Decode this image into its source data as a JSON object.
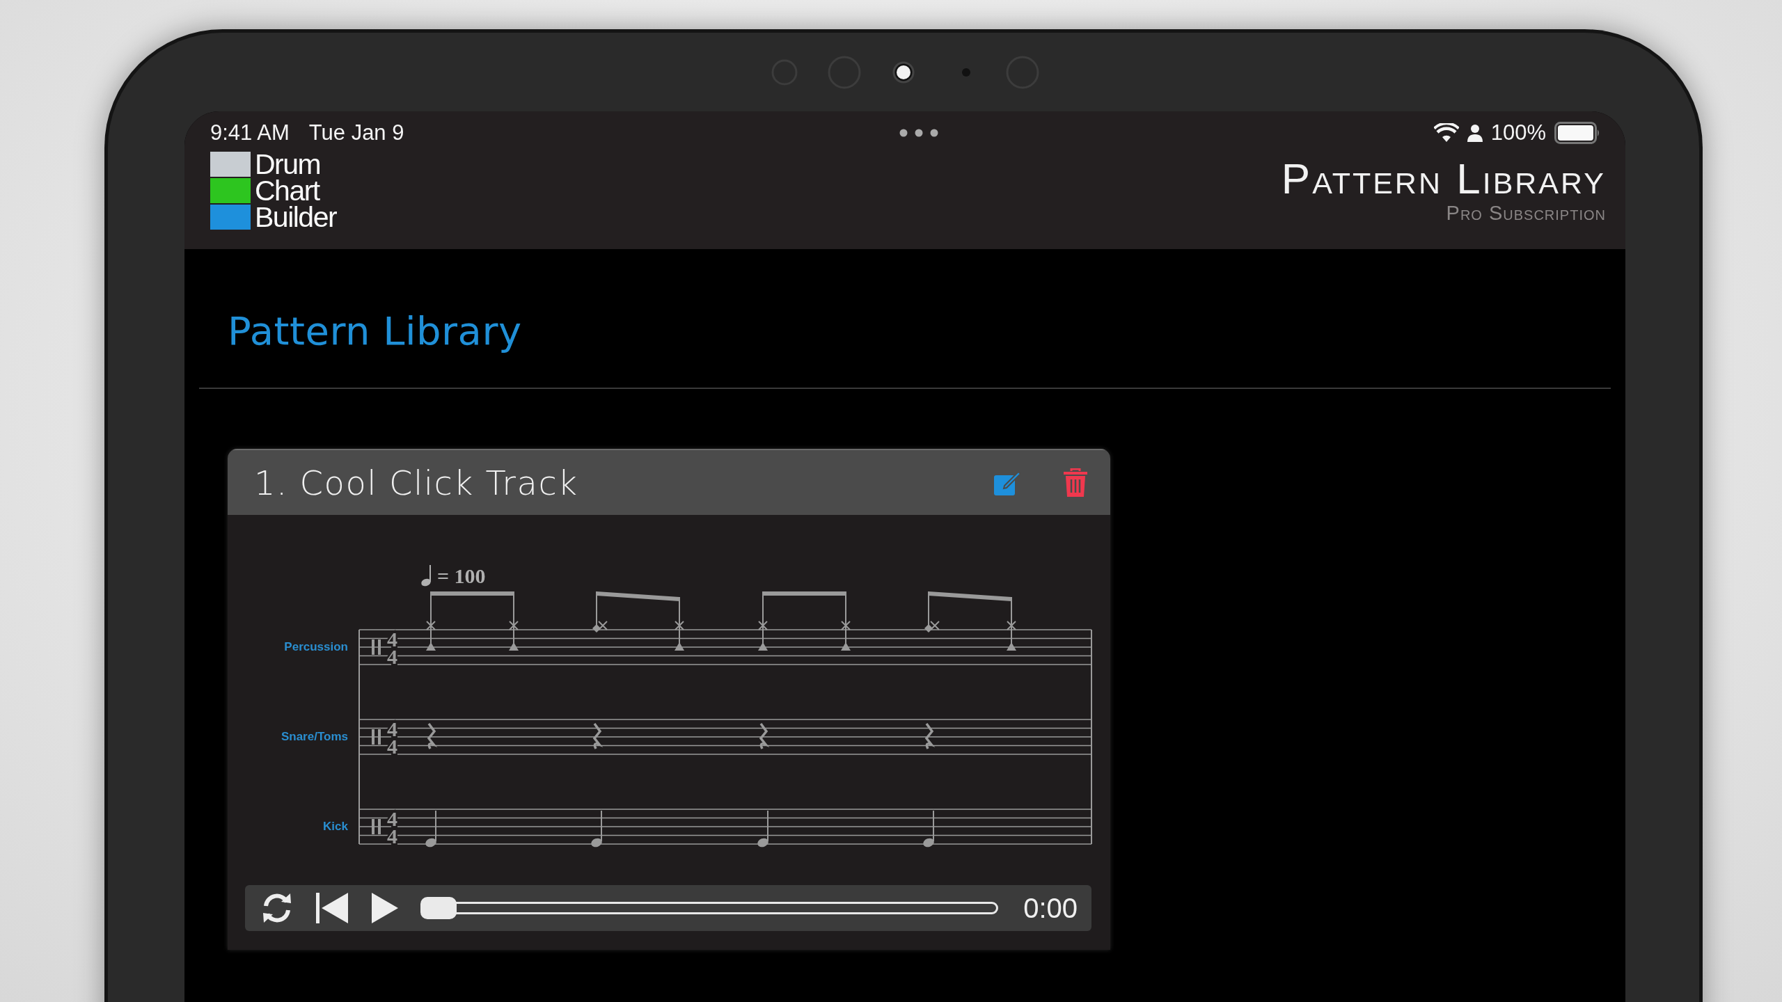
{
  "status_bar": {
    "time": "9:41 AM",
    "date": "Tue Jan 9",
    "battery": "100%"
  },
  "header": {
    "logo": [
      {
        "text": "Drum",
        "color": "#c8cdd2"
      },
      {
        "text": "Chart",
        "color": "#2dc51f"
      },
      {
        "text": "Builder",
        "color": "#1e90dc"
      }
    ],
    "title": "Pattern Library",
    "subtitle": "Pro Subscription"
  },
  "page_title": "Pattern Library",
  "patterns": [
    {
      "title": "1. Cool Click Track",
      "score": {
        "tempo": "= 100",
        "staves": [
          {
            "name": "Percussion",
            "kind": "cymbal",
            "time_signature": [
              "4",
              "4"
            ]
          },
          {
            "name": "Snare/Toms",
            "kind": "rest",
            "time_signature": [
              "4",
              "4"
            ]
          },
          {
            "name": "Kick",
            "kind": "kick",
            "time_signature": [
              "4",
              "4"
            ]
          }
        ]
      },
      "player": {
        "level": 0,
        "time": "0:00"
      }
    }
  ]
}
